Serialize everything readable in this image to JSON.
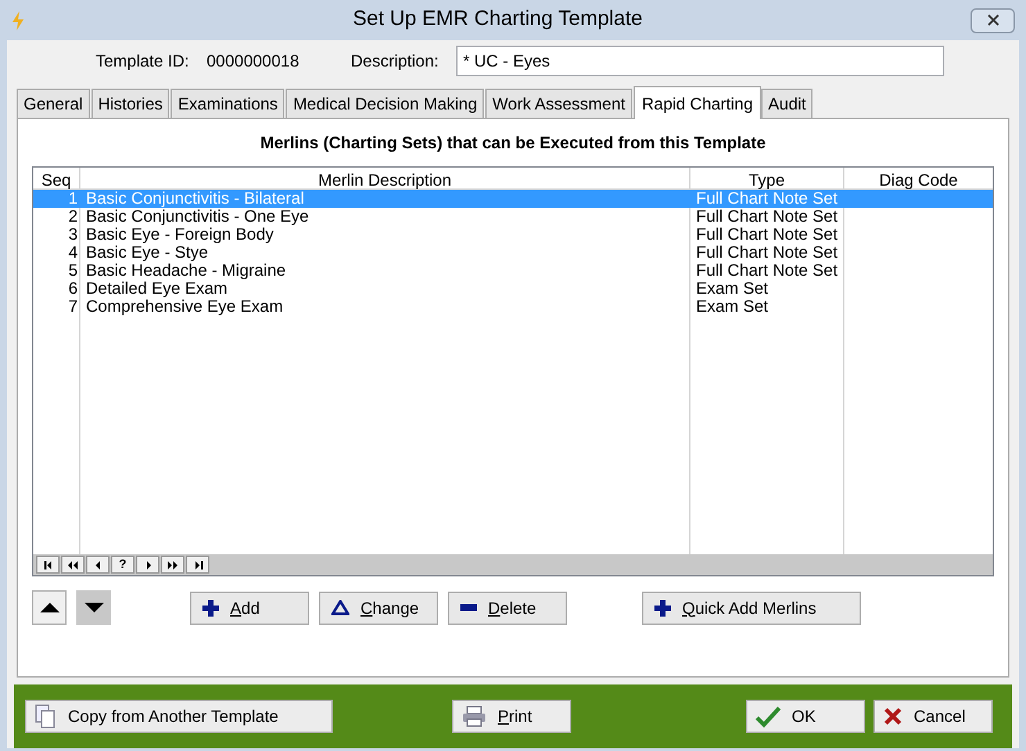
{
  "window": {
    "title": "Set Up EMR Charting Template"
  },
  "header": {
    "template_id_label": "Template ID:",
    "template_id": "0000000018",
    "description_label": "Description:",
    "description": "* UC - Eyes"
  },
  "tabs": [
    {
      "label": "General",
      "selected": false
    },
    {
      "label": "Histories",
      "selected": false
    },
    {
      "label": "Examinations",
      "selected": false
    },
    {
      "label": "Medical Decision Making",
      "selected": false
    },
    {
      "label": "Work Assessment",
      "selected": false
    },
    {
      "label": "Rapid Charting",
      "selected": true
    },
    {
      "label": "Audit",
      "selected": false
    }
  ],
  "section_title": "Merlins (Charting Sets) that can be Executed from this Template",
  "table": {
    "columns": [
      "Seq",
      "Merlin Description",
      "Type",
      "Diag Code"
    ],
    "rows": [
      {
        "seq": "1",
        "description": "Basic Conjunctivitis - Bilateral",
        "type": "Full Chart Note Set",
        "selected": true
      },
      {
        "seq": "2",
        "description": "Basic Conjunctivitis - One Eye",
        "type": "Full Chart Note Set",
        "selected": false
      },
      {
        "seq": "3",
        "description": "Basic Eye - Foreign Body",
        "type": "Full Chart Note Set",
        "selected": false
      },
      {
        "seq": "4",
        "description": "Basic Eye - Stye",
        "type": "Full Chart Note Set",
        "selected": false
      },
      {
        "seq": "5",
        "description": "Basic Headache - Migraine",
        "type": "Full Chart Note Set",
        "selected": false
      },
      {
        "seq": "6",
        "description": "Detailed Eye Exam",
        "type": "Exam Set",
        "selected": false
      },
      {
        "seq": "7",
        "description": "Comprehensive Eye Exam",
        "type": "Exam Set",
        "selected": false
      }
    ]
  },
  "navigator": [
    {
      "kind": "first"
    },
    {
      "kind": "prev-page"
    },
    {
      "kind": "prev"
    },
    {
      "kind": "text",
      "label": "?"
    },
    {
      "kind": "next"
    },
    {
      "kind": "next-page"
    },
    {
      "kind": "last"
    }
  ],
  "move_buttons": [
    {
      "kind": "up",
      "pressed": false
    },
    {
      "kind": "down",
      "pressed": true
    }
  ],
  "actions": [
    {
      "kind": "add",
      "label": "Add"
    },
    {
      "kind": "change",
      "label": "Change"
    },
    {
      "kind": "delete",
      "label": "Delete"
    },
    {
      "kind": "quick",
      "label": "Quick Add Merlins"
    }
  ],
  "footer": [
    {
      "kind": "copy",
      "label": "Copy from Another Template",
      "mnemonic": false
    },
    {
      "kind": "print",
      "label": "Print",
      "mnemonic": true
    },
    {
      "kind": "ok",
      "label": "OK",
      "mnemonic": false
    },
    {
      "kind": "cancel",
      "label": "Cancel",
      "mnemonic": false
    }
  ]
}
